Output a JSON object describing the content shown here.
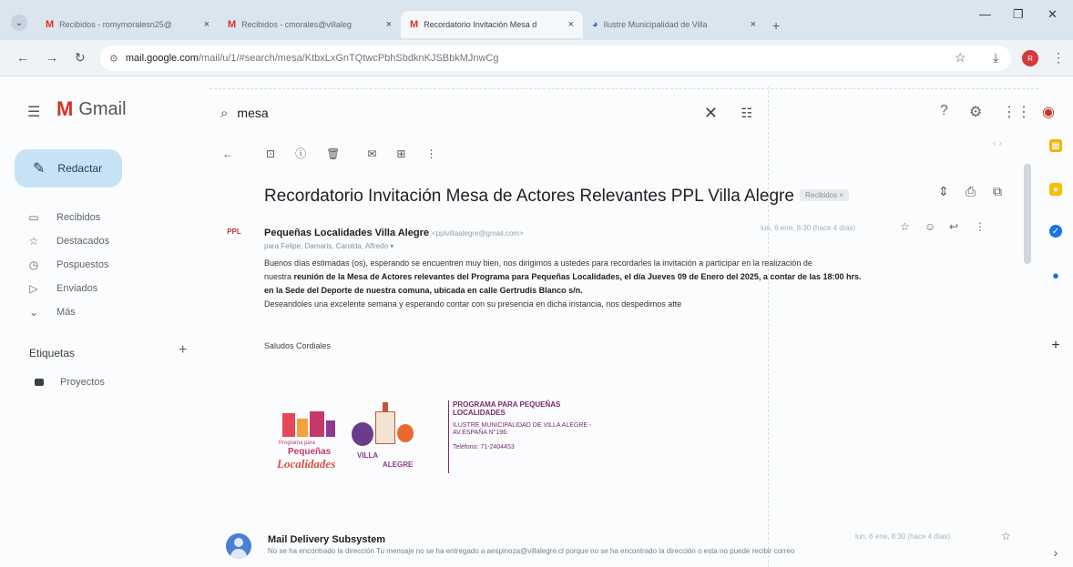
{
  "browser": {
    "tabs": [
      {
        "icon": "M",
        "label": "Recibidos - romymoralesn25@",
        "active": false
      },
      {
        "icon": "M",
        "label": "Recibidos - cmorales@villaleg",
        "active": false
      },
      {
        "icon": "M",
        "label": "Recordatorio Invitación Mesa d",
        "active": true
      },
      {
        "icon": "◕",
        "label": "Ilustre Municipalidad de Villa",
        "active": false
      }
    ],
    "close_glyph": "×",
    "new_tab": "+",
    "url_host": "mail.google.com",
    "url_path": "/mail/u/1/#search/mesa/KtbxLxGnTQtwcPbhSbdknKJSBbkMJnwCg",
    "profile_initial": "R"
  },
  "gmail": {
    "app_name": "Gmail",
    "search_value": "mesa",
    "compose_label": "Redactar",
    "nav": [
      {
        "icon": "inbox-icon",
        "glyph": "▭",
        "label": "Recibidos"
      },
      {
        "icon": "star-icon",
        "glyph": "☆",
        "label": "Destacados"
      },
      {
        "icon": "clock-icon",
        "glyph": "◷",
        "label": "Pospuestos"
      },
      {
        "icon": "send-icon",
        "glyph": "▷",
        "label": "Enviados"
      },
      {
        "icon": "chevron-down-icon",
        "glyph": "⌄",
        "label": "Más"
      }
    ],
    "labels_header": "Etiquetas",
    "labels": [
      {
        "label": "Proyectos"
      }
    ]
  },
  "email": {
    "subject": "Recordatorio Invitación Mesa de Actores Relevantes PPL Villa Alegre",
    "label_chip": "Recibidos ×",
    "sender_logo_text": "PPL",
    "sender_name": "Pequeñas Localidades Villa Alegre",
    "sender_email": "<pplvillaalegre@gmail.com>",
    "recipients": "para Felipe, Damaris, Carolda, Alfredo ▾",
    "date": "lun, 6 ene, 8:30 (hace 4 días)",
    "body_line1": "Buenos días estimadas (os), esperando se encuentren muy bien, nos dirigimos a ustedes para recordarles la invitación a participar en la realización de",
    "body_line2_pre": "nuestra",
    "body_line2_bold": "reunión de la Mesa de Actores relevantes del Programa para Pequeñas Localidades, el día Jueves 09 de Enero del 2025, a contar de las 18:00 hrs.",
    "body_line3_bold": "en la Sede del Deporte de nuestra comuna, ubicada en calle Gertrudis Blanco s/n.",
    "body_line4": "Deseandoles una excelente semana y esperando contar con su presencia en dicha instancia,  nos despedimos atte",
    "greeting": "Saludos Cordiales",
    "signature": {
      "logo_line1": "Programa para",
      "logo_line2": "Pequeñas",
      "logo_line3": "Localidades",
      "logo_villa": "VILLA",
      "logo_alegre": "ALEGRE",
      "title": "PROGRAMA PARA PEQUEÑAS LOCALIDADES",
      "address": "ILUSTRE MUNICIPALIDAD DE VILLA ALEGRE - AV.ESPAÑA N°196.",
      "phone": "Teléfono: 71-2404453"
    }
  },
  "next_message": {
    "from": "Mail Delivery Subsystem",
    "snippet": "No se ha encontrado la dirección Tu mensaje no se ha entregado a aespinoza@villalegre.cl porque no se ha encontrado la dirección o esta no puede recibir correo",
    "date": "lun, 6 ene, 8:30 (hace 4 días)"
  },
  "colors": {
    "compose_bg": "#c6e2f4",
    "accent_purple": "#7b2a6e",
    "gmail_red": "#d93025"
  }
}
